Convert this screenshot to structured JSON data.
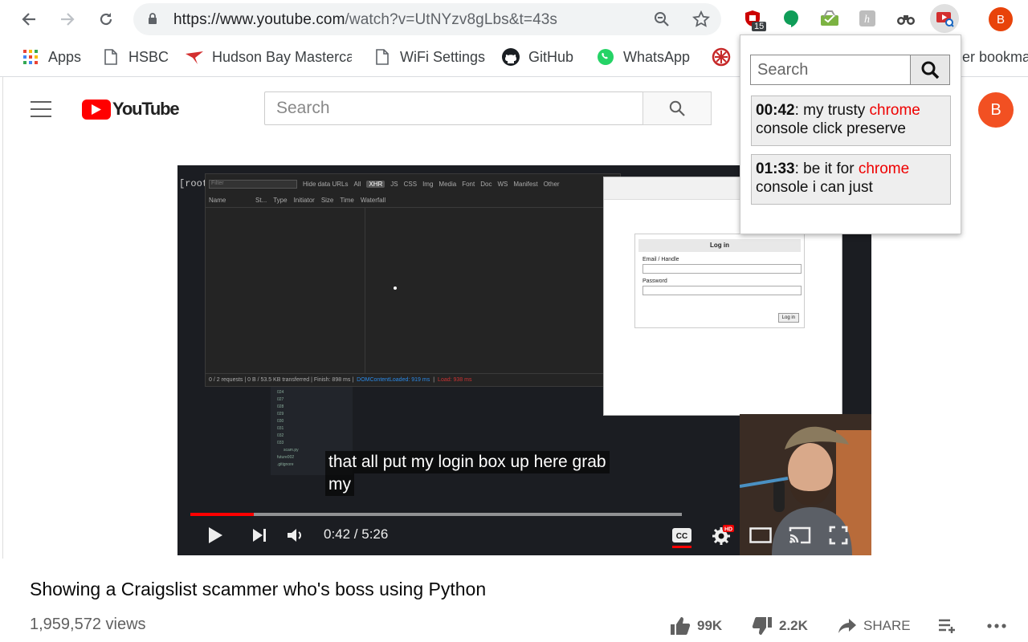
{
  "browser": {
    "url_host": "https://www.youtube.com",
    "url_rest": "/watch?v=UtNYzv8gLbs&t=43s",
    "extension_badge": "15",
    "profile_initial": "B"
  },
  "bookmarks": [
    {
      "label": "Apps",
      "icon": "apps-grid-icon"
    },
    {
      "label": "HSBC",
      "icon": "page-icon"
    },
    {
      "label": "Hudson Bay Masterca",
      "icon": "hudson-bay-icon"
    },
    {
      "label": "WiFi Settings",
      "icon": "page-icon"
    },
    {
      "label": "GitHub",
      "icon": "github-icon"
    },
    {
      "label": "WhatsApp",
      "icon": "whatsapp-icon"
    },
    {
      "label": "er bookma",
      "icon": "folder-icon"
    }
  ],
  "youtube": {
    "logo_text": "YouTube",
    "search_placeholder": "Search",
    "avatar_initial": "B"
  },
  "player": {
    "caption_line1": "that all put my login box up here grab",
    "caption_line2": "my",
    "time_current": "0:42",
    "time_total": "5:26",
    "time_display": "0:42 / 5:26",
    "played_fraction": 0.129,
    "buffered_fraction": 1.0,
    "hd_badge": "HD",
    "cc_label": "CC",
    "inner_screen": {
      "root_prompt": "[root",
      "devtools_filter_placeholder": "Filter",
      "devtools_hide_data_urls": "Hide data URLs",
      "devtools_types": [
        "All",
        "XHR",
        "JS",
        "CSS",
        "Img",
        "Media",
        "Font",
        "Doc",
        "WS",
        "Manifest",
        "Other"
      ],
      "devtools_columns": [
        "Name",
        "St...",
        "Type",
        "Initiator",
        "Size",
        "Time",
        "Waterfall"
      ],
      "devtools_status": "0 / 2 requests  |  0 B / 53.5 KB transferred  |  Finish: 898 ms  |",
      "devtools_dcl": "DOMContentLoaded: 919 ms",
      "devtools_load": "Load: 938 ms",
      "login_title": "Log in",
      "login_email_label": "Email / Handle",
      "login_password_label": "Password",
      "login_button": "Log in",
      "tree_items": [
        "024",
        "027",
        "028",
        "029",
        "030",
        "031",
        "032",
        "033",
        "scam.py",
        "future002",
        ".gitignore"
      ]
    }
  },
  "video": {
    "title": "Showing a Craigslist scammer who's boss using Python",
    "views": "1,959,572 views",
    "likes": "99K",
    "dislikes": "2.2K",
    "share_label": "SHARE"
  },
  "popup": {
    "search_placeholder": "Search",
    "results": [
      {
        "timestamp": "00:42",
        "pre": ": my trusty ",
        "highlight": "chrome",
        "post": " console click preserve"
      },
      {
        "timestamp": "01:33",
        "pre": ": be it for ",
        "highlight": "chrome",
        "post": " console i can just"
      }
    ]
  }
}
